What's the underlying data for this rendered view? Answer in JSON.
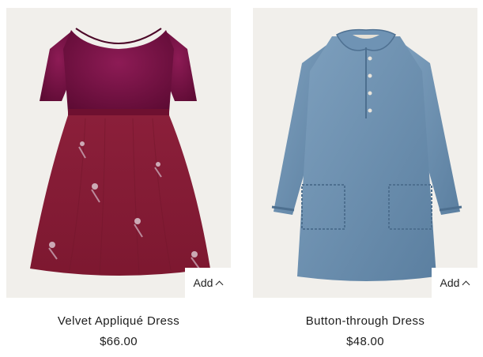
{
  "products": [
    {
      "name": "Velvet Appliqué Dress",
      "price": "$66.00",
      "add_label": "Add",
      "colors": {
        "bodice": "#7a1143",
        "skirt": "#8a1e36",
        "background": "#f1efeb"
      }
    },
    {
      "name": "Button-through Dress",
      "price": "$48.00",
      "add_label": "Add",
      "colors": {
        "denim": "#6a8fb0",
        "background": "#f1efeb"
      }
    }
  ],
  "icons": {
    "add_chevron": "chevron-up-icon"
  }
}
